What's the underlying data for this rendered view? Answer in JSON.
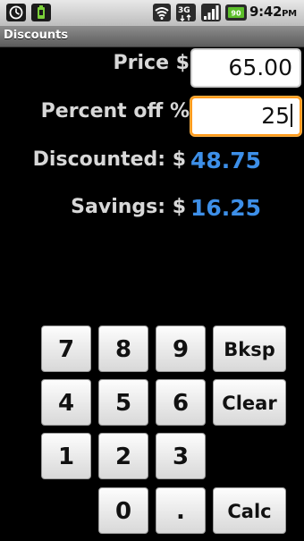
{
  "status_bar": {
    "time": "9:42",
    "ampm": "PM",
    "battery_level": "90",
    "network": "3G",
    "icons": [
      "app-notification-icon",
      "battery-app-notification-icon",
      "wifi-icon",
      "3g-icon",
      "signal-icon",
      "battery-icon"
    ]
  },
  "app": {
    "title": "Discounts"
  },
  "form": {
    "price_label": "Price $",
    "price_value": "65.00",
    "percent_label": "Percent off %",
    "percent_value": "25",
    "discounted_label": "Discounted: $",
    "discounted_value": "48.75",
    "savings_label": "Savings: $",
    "savings_value": "16.25"
  },
  "keypad": {
    "k7": "7",
    "k8": "8",
    "k9": "9",
    "bksp": "Bksp",
    "k4": "4",
    "k5": "5",
    "k6": "6",
    "clear": "Clear",
    "k1": "1",
    "k2": "2",
    "k3": "3",
    "k0": "0",
    "dot": ".",
    "calc": "Calc"
  },
  "colors": {
    "result": "#3d8fe8",
    "focus_border": "#ff9a1c",
    "background": "#000000"
  }
}
